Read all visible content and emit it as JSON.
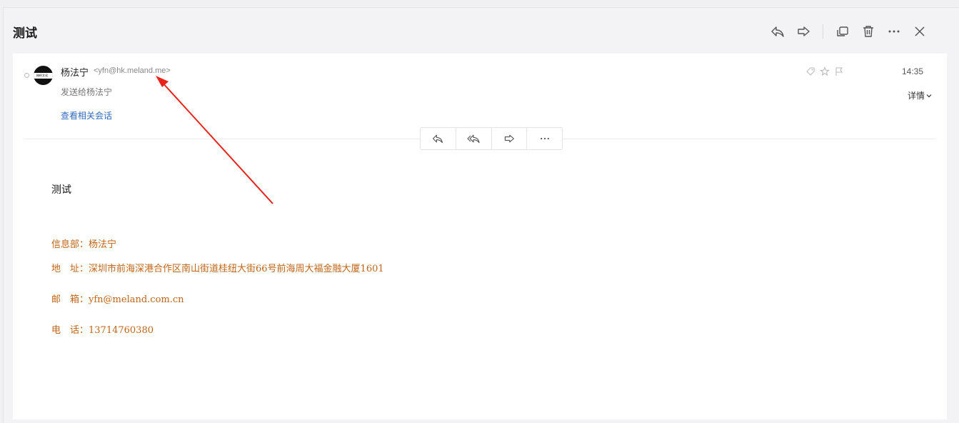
{
  "header": {
    "subject": "测试",
    "toolbar": [
      "reply-icon",
      "forward-icon",
      "new-window-icon",
      "delete-icon",
      "more-icon",
      "close-icon"
    ]
  },
  "message": {
    "sender_name": "杨法宁",
    "sender_email": "<yfn@hk.meland.me>",
    "sent_to": "发送给杨法宁",
    "related_link": "查看相关会话",
    "time": "14:35",
    "detail": "详情",
    "avatar_text": "梅岭文化",
    "actions": [
      "reply-icon",
      "reply-all-icon",
      "forward-icon",
      "more-icon"
    ]
  },
  "body": {
    "text": "测试",
    "signature": [
      {
        "label": "信息部：",
        "value": "杨法宁"
      },
      {
        "label": "地　址：",
        "value": "深圳市前海深港合作区南山街道桂纽大街66号前海周大福金融大厦1601"
      },
      {
        "label": "邮　箱：",
        "value": "yfn@meland.com.cn"
      },
      {
        "label": "电　话：",
        "value": "13714760380"
      }
    ]
  },
  "colors": {
    "accent": "#2f6bc1",
    "signature": "#c0651a",
    "annotation_arrow": "#e8231b"
  }
}
